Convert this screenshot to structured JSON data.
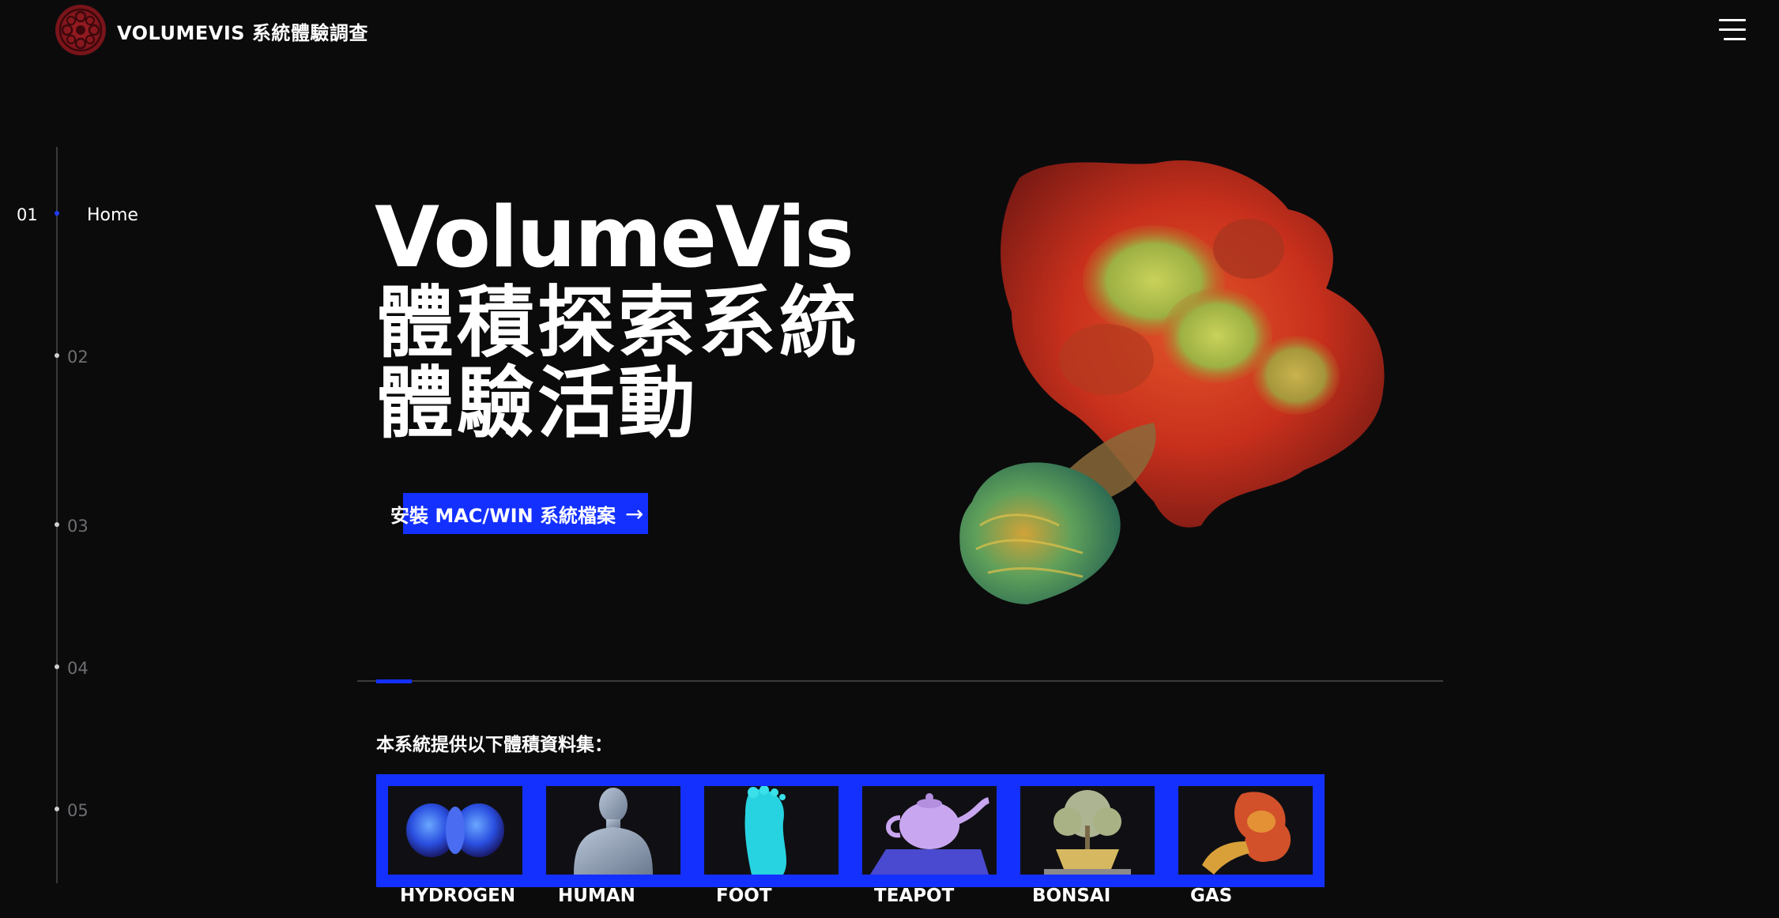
{
  "header": {
    "brand": "VOLUMEVIS 系統體驗調查",
    "logo_icon": "film-reel-logo-icon",
    "menu_icon": "hamburger-menu-icon"
  },
  "timeline": {
    "active_number": "01",
    "active_label": "Home",
    "steps": [
      "02",
      "03",
      "04",
      "05"
    ]
  },
  "hero": {
    "title_en": "VolumeVis",
    "title_zh_line1": "體積探索系統",
    "title_zh_line2": "體驗活動",
    "cta_label": "安裝 MAC/WIN 系統檔案",
    "cta_icon": "arrow-right-icon"
  },
  "datasets": {
    "heading": "本系統提供以下體積資料集：",
    "items": [
      {
        "label": "HYDROGEN"
      },
      {
        "label": "HUMAN"
      },
      {
        "label": "FOOT"
      },
      {
        "label": "TEAPOT"
      },
      {
        "label": "BONSAI"
      },
      {
        "label": "GAS"
      }
    ]
  },
  "colors": {
    "background": "#0b0b0c",
    "accent": "#1430ff",
    "logo": "#8b1a20"
  }
}
